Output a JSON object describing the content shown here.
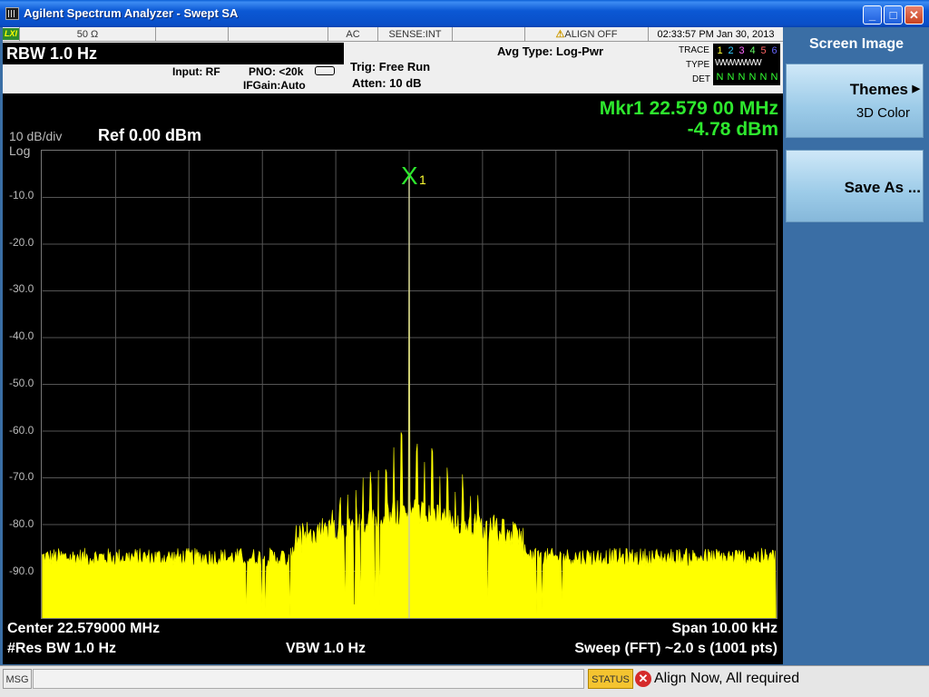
{
  "window": {
    "title": "Agilent Spectrum Analyzer - Swept SA",
    "minimize_glyph": "_",
    "maximize_glyph": "□",
    "close_glyph": "✕"
  },
  "status_strip": {
    "lxi": "LXI",
    "impedance": "50 Ω",
    "coupling": "AC",
    "sense": "SENSE:INT",
    "align": "ALIGN OFF",
    "datetime": "02:33:57 PM Jan 30, 2013"
  },
  "header": {
    "rbw": "RBW  1.0 Hz",
    "input": "Input: RF",
    "pno": "PNO: <20k",
    "ifgain": "IFGain:Auto",
    "trig": "Trig: Free Run",
    "atten": "Atten: 10 dB",
    "avg_type": "Avg Type: Log-Pwr",
    "trace_label": "TRACE",
    "type_label": "TYPE",
    "det_label": "DET",
    "trace_numbers": [
      "1",
      "2",
      "3",
      "4",
      "5",
      "6"
    ],
    "trace_colors": [
      "#ffff33",
      "#33ccff",
      "#ff66ff",
      "#66ff66",
      "#ff6666",
      "#6666ff"
    ],
    "type_value": "WWWWWW",
    "det_values": [
      "N",
      "N",
      "N",
      "N",
      "N",
      "N"
    ]
  },
  "display": {
    "scale": "10 dB/div",
    "log": "Log",
    "ref": "Ref 0.00 dBm",
    "marker_freq": "Mkr1 22.579 00 MHz",
    "marker_amp": "-4.78 dBm",
    "marker_symbol": "X",
    "marker_index": "1",
    "y_labels": [
      "-10.0",
      "-20.0",
      "-30.0",
      "-40.0",
      "-50.0",
      "-60.0",
      "-70.0",
      "-80.0",
      "-90.0"
    ],
    "center": "Center 22.579000 MHz",
    "span": "Span 10.00 kHz",
    "res_bw": "#Res BW 1.0 Hz",
    "vbw": "VBW 1.0 Hz",
    "sweep": "Sweep (FFT)  ~2.0 s (1001 pts)"
  },
  "softkeys": {
    "title": "Screen Image",
    "themes_label": "Themes",
    "themes_value": "3D Color",
    "save_as": "Save As ..."
  },
  "statusbar": {
    "msg": "MSG",
    "status_btn": "STATUS",
    "message": "Align Now, All required"
  },
  "colors": {
    "trace": "#ffff00",
    "marker": "#2ee82e",
    "grid": "#555555"
  }
}
